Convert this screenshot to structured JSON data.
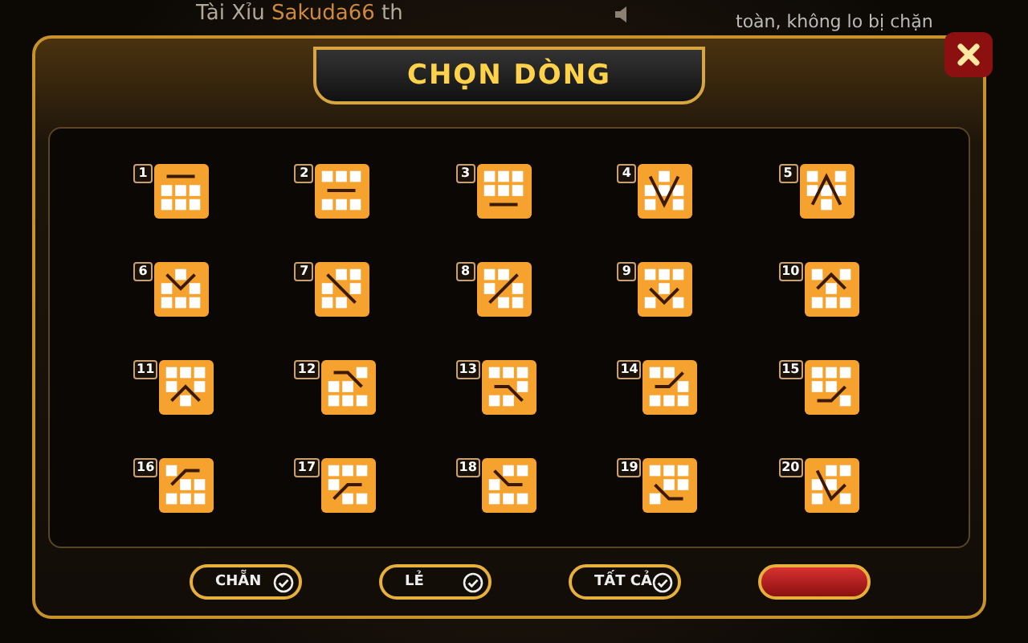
{
  "top_bar": {
    "ticker_left": "Tài Xỉu **Sakuda66** th",
    "ticker_right": "toàn, không lo bị chặn"
  },
  "dialog": {
    "title": "CHỌN DÒNG",
    "lines": [
      {
        "number": "1",
        "kind": "top"
      },
      {
        "number": "2",
        "kind": "middle"
      },
      {
        "number": "3",
        "kind": "bottom"
      },
      {
        "number": "4",
        "kind": "v"
      },
      {
        "number": "5",
        "kind": "caret"
      },
      {
        "number": "6",
        "kind": "v-high"
      },
      {
        "number": "7",
        "kind": "descend"
      },
      {
        "number": "8",
        "kind": "ascend"
      },
      {
        "number": "9",
        "kind": "v-low"
      },
      {
        "number": "10",
        "kind": "caret-high"
      },
      {
        "number": "11",
        "kind": "caret-low"
      },
      {
        "number": "12",
        "kind": "drop-end"
      },
      {
        "number": "13",
        "kind": "drop-mid-end"
      },
      {
        "number": "14",
        "kind": "rise-mid"
      },
      {
        "number": "15",
        "kind": "rise-end"
      },
      {
        "number": "16",
        "kind": "rise-start"
      },
      {
        "number": "17",
        "kind": "rise-low"
      },
      {
        "number": "18",
        "kind": "drop-start"
      },
      {
        "number": "19",
        "kind": "drop-low"
      },
      {
        "number": "20",
        "kind": "v-skew"
      }
    ],
    "buttons": [
      {
        "label": "CHẴN"
      },
      {
        "label": "LẺ"
      },
      {
        "label": "TẤT CẢ"
      }
    ]
  }
}
